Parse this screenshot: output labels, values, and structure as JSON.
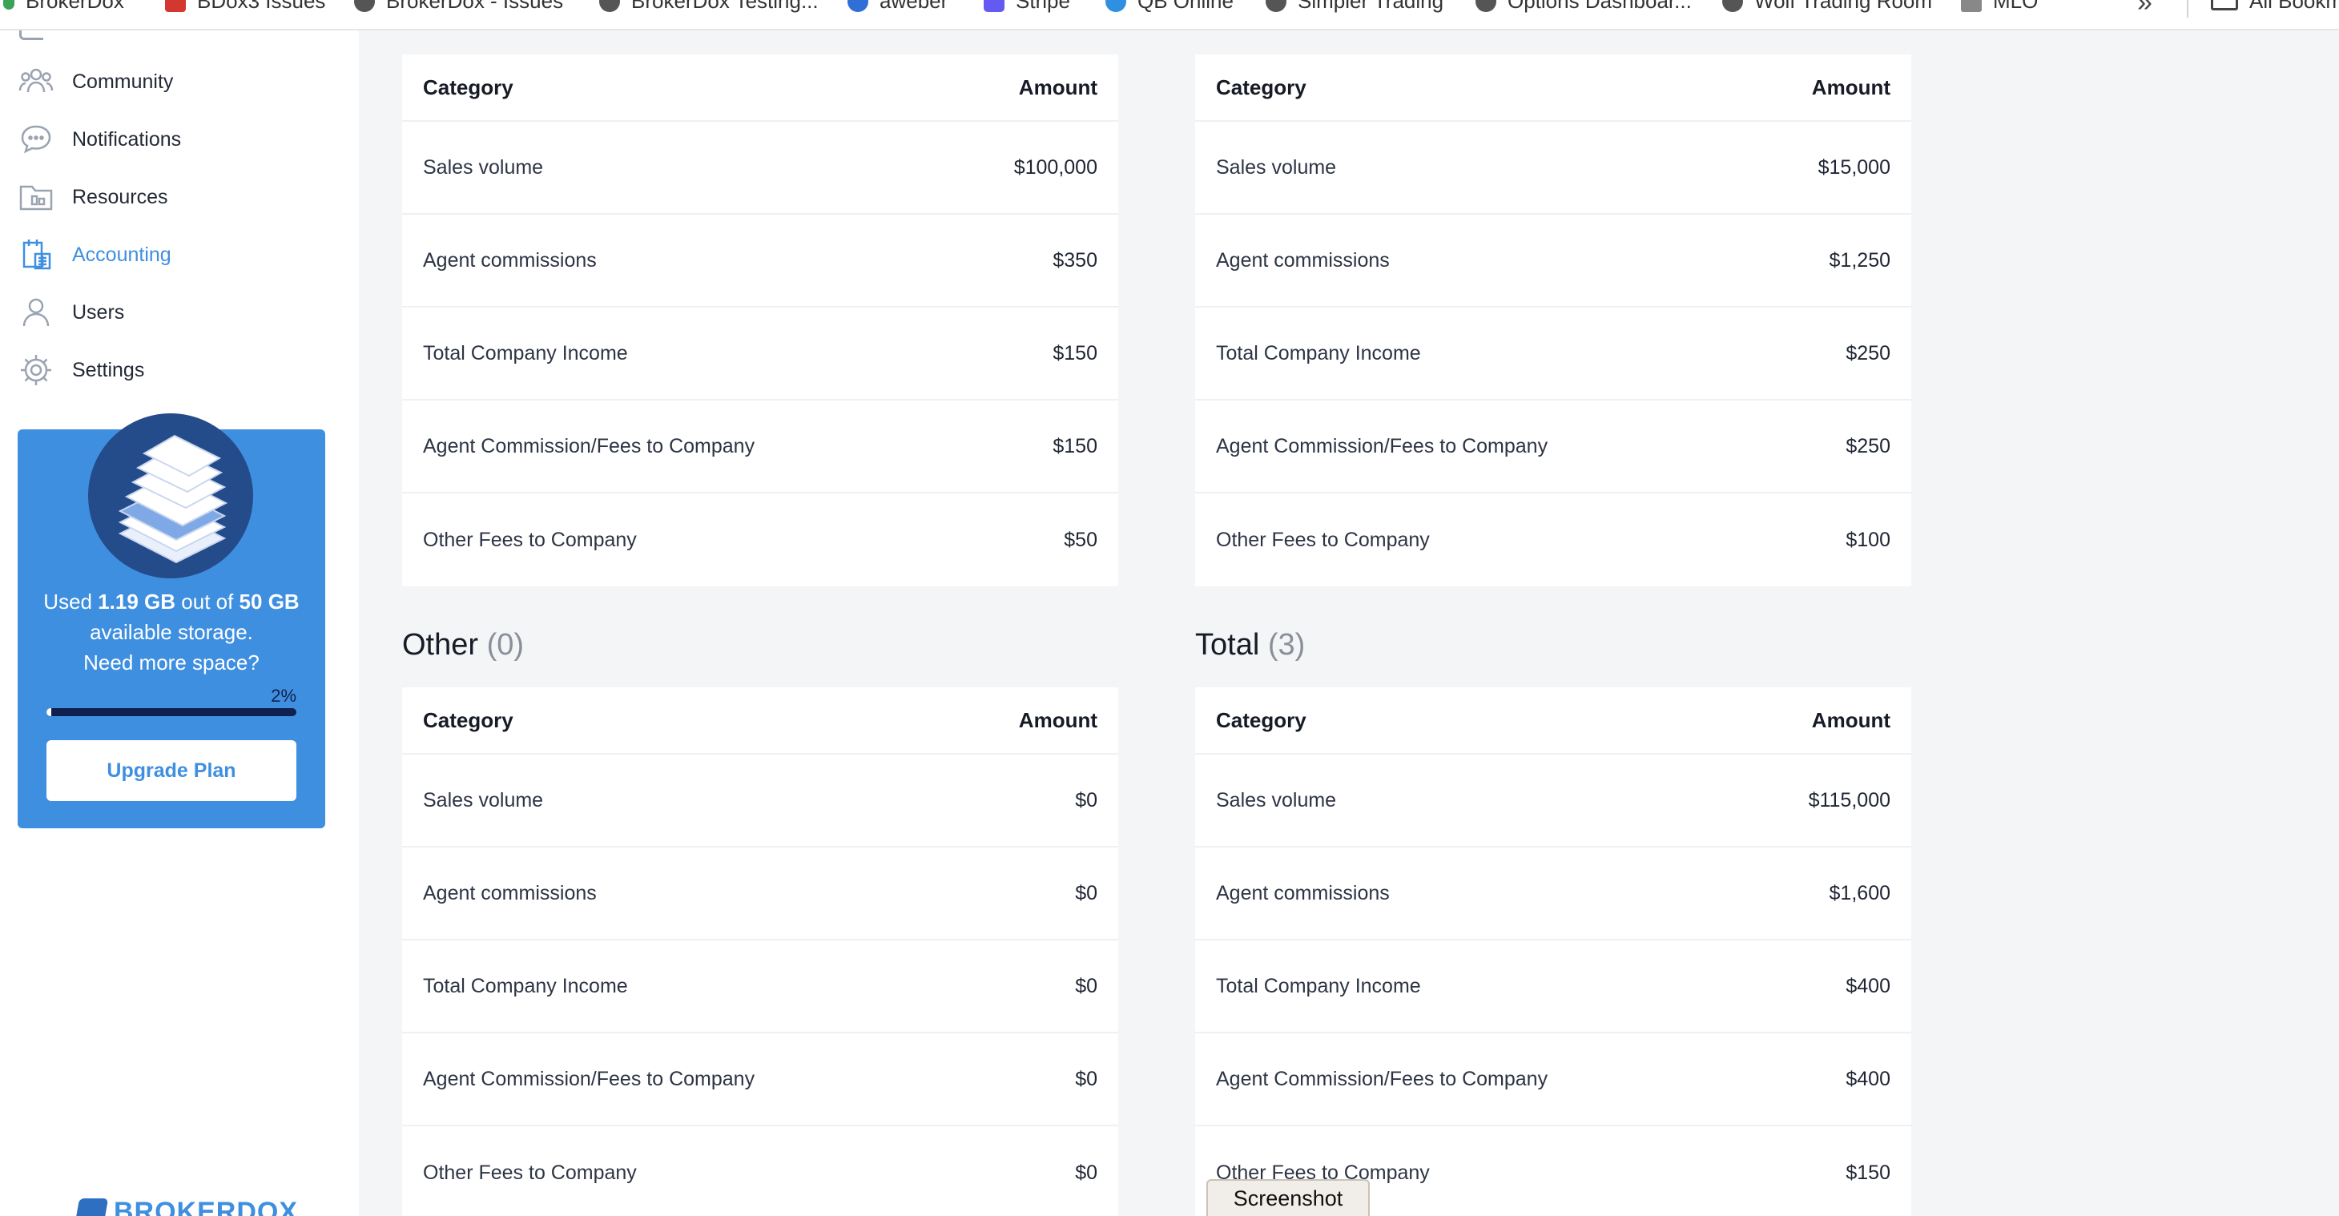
{
  "bookmarks": {
    "items": [
      {
        "label": "BrokerDox",
        "color": "#3aa356"
      },
      {
        "label": "BDox3 Issues",
        "color": "#d2382f"
      },
      {
        "label": "BrokerDox - Issues",
        "color": "#555555"
      },
      {
        "label": "BrokerDox Testing...",
        "color": "#555555"
      },
      {
        "label": "aweber",
        "color": "#2f6fd6"
      },
      {
        "label": "Stripe",
        "color": "#6459f0"
      },
      {
        "label": "QB Online",
        "color": "#2f8fe0"
      },
      {
        "label": "Simpler Trading",
        "color": "#555555"
      },
      {
        "label": "Options Dashboar...",
        "color": "#555555"
      },
      {
        "label": "Wolf Trading Room",
        "color": "#555555"
      },
      {
        "label": "MLO",
        "color": "#888888"
      }
    ],
    "more": "»",
    "all_label": "All Bookm"
  },
  "sidebar": {
    "items": [
      {
        "label": "Community",
        "icon": "community-icon",
        "active": false
      },
      {
        "label": "Notifications",
        "icon": "chat-bubble-icon",
        "active": false
      },
      {
        "label": "Resources",
        "icon": "folder-icon",
        "active": false
      },
      {
        "label": "Accounting",
        "icon": "calculator-icon",
        "active": true
      },
      {
        "label": "Users",
        "icon": "user-icon",
        "active": false
      },
      {
        "label": "Settings",
        "icon": "gear-icon",
        "active": false
      }
    ],
    "storage": {
      "used_prefix": "Used ",
      "used_value": "1.19 GB",
      "out_of": " out of ",
      "total_value": "50 GB",
      "available": " available storage.",
      "need_more": "Need more space?",
      "percent_label": "2%",
      "percent": 0.02,
      "upgrade_label": "Upgrade Plan"
    },
    "logo_text": "BROKERDOX"
  },
  "tables": {
    "header_category": "Category",
    "header_amount": "Amount",
    "top_left": [
      {
        "category": "Sales volume",
        "amount": "$100,000"
      },
      {
        "category": "Agent commissions",
        "amount": "$350"
      },
      {
        "category": "Total Company Income",
        "amount": "$150"
      },
      {
        "category": "Agent Commission/Fees to Company",
        "amount": "$150"
      },
      {
        "category": "Other Fees to Company",
        "amount": "$50"
      }
    ],
    "top_right": [
      {
        "category": "Sales volume",
        "amount": "$15,000"
      },
      {
        "category": "Agent commissions",
        "amount": "$1,250"
      },
      {
        "category": "Total Company Income",
        "amount": "$250"
      },
      {
        "category": "Agent Commission/Fees to Company",
        "amount": "$250"
      },
      {
        "category": "Other Fees to Company",
        "amount": "$100"
      }
    ],
    "other": {
      "title": "Other",
      "count": "(0)",
      "rows": [
        {
          "category": "Sales volume",
          "amount": "$0"
        },
        {
          "category": "Agent commissions",
          "amount": "$0"
        },
        {
          "category": "Total Company Income",
          "amount": "$0"
        },
        {
          "category": "Agent Commission/Fees to Company",
          "amount": "$0"
        },
        {
          "category": "Other Fees to Company",
          "amount": "$0"
        }
      ]
    },
    "total": {
      "title": "Total",
      "count": "(3)",
      "rows": [
        {
          "category": "Sales volume",
          "amount": "$115,000"
        },
        {
          "category": "Agent commissions",
          "amount": "$1,600"
        },
        {
          "category": "Total Company Income",
          "amount": "$400"
        },
        {
          "category": "Agent Commission/Fees to Company",
          "amount": "$400"
        },
        {
          "category": "Other Fees to Company",
          "amount": "$150"
        }
      ]
    }
  },
  "tooltip": "Screenshot",
  "colors": {
    "accent": "#3f8fe0",
    "storage_dark": "#244b8a"
  }
}
